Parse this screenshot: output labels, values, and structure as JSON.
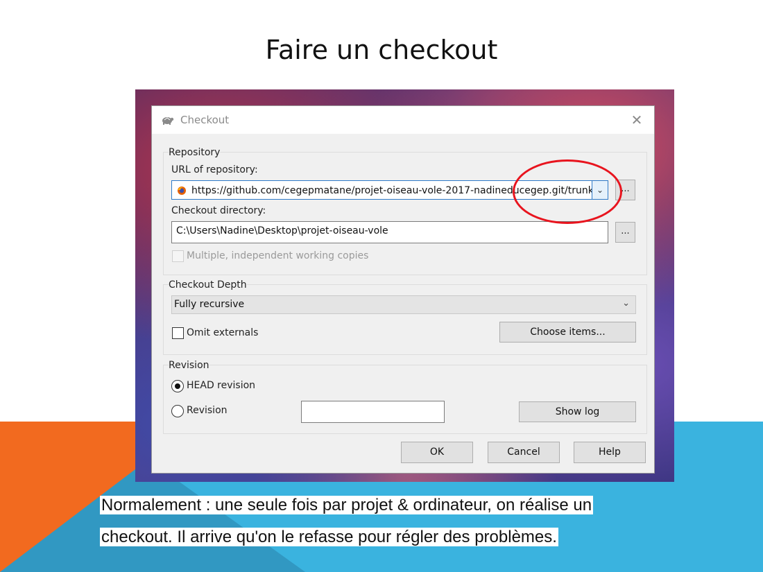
{
  "slide": {
    "title": "Faire un checkout",
    "caption_line1": "Normalement : une seule fois par projet & ordinateur, on réalise un",
    "caption_line2": "checkout.  Il arrive qu'on le refasse pour régler des problèmes."
  },
  "dialog": {
    "title": "Checkout",
    "icon": "tortoise-icon",
    "close_glyph": "✕",
    "repository": {
      "group_label": "Repository",
      "url_label": "URL of repository:",
      "url_value": "https://github.com/cegepmatane/projet-oiseau-vole-2017-nadineducegep.git/trunk",
      "browse_label": "...",
      "dir_label": "Checkout directory:",
      "dir_value": "C:\\Users\\Nadine\\Desktop\\projet-oiseau-vole",
      "dir_browse_label": "...",
      "multiple_label": "Multiple, independent working copies",
      "multiple_checked": false,
      "multiple_enabled": false
    },
    "depth": {
      "group_label": "Checkout Depth",
      "selected": "Fully recursive",
      "omit_label": "Omit externals",
      "omit_checked": false,
      "choose_items_label": "Choose items..."
    },
    "revision": {
      "group_label": "Revision",
      "head_label": "HEAD revision",
      "head_selected": true,
      "revision_label": "Revision",
      "revision_value": "",
      "show_log_label": "Show log"
    },
    "buttons": {
      "ok": "OK",
      "cancel": "Cancel",
      "help": "Help"
    }
  },
  "colors": {
    "highlight": "#e8141e",
    "accent_blue": "#3ab3df",
    "accent_orange": "#f26a1f"
  }
}
